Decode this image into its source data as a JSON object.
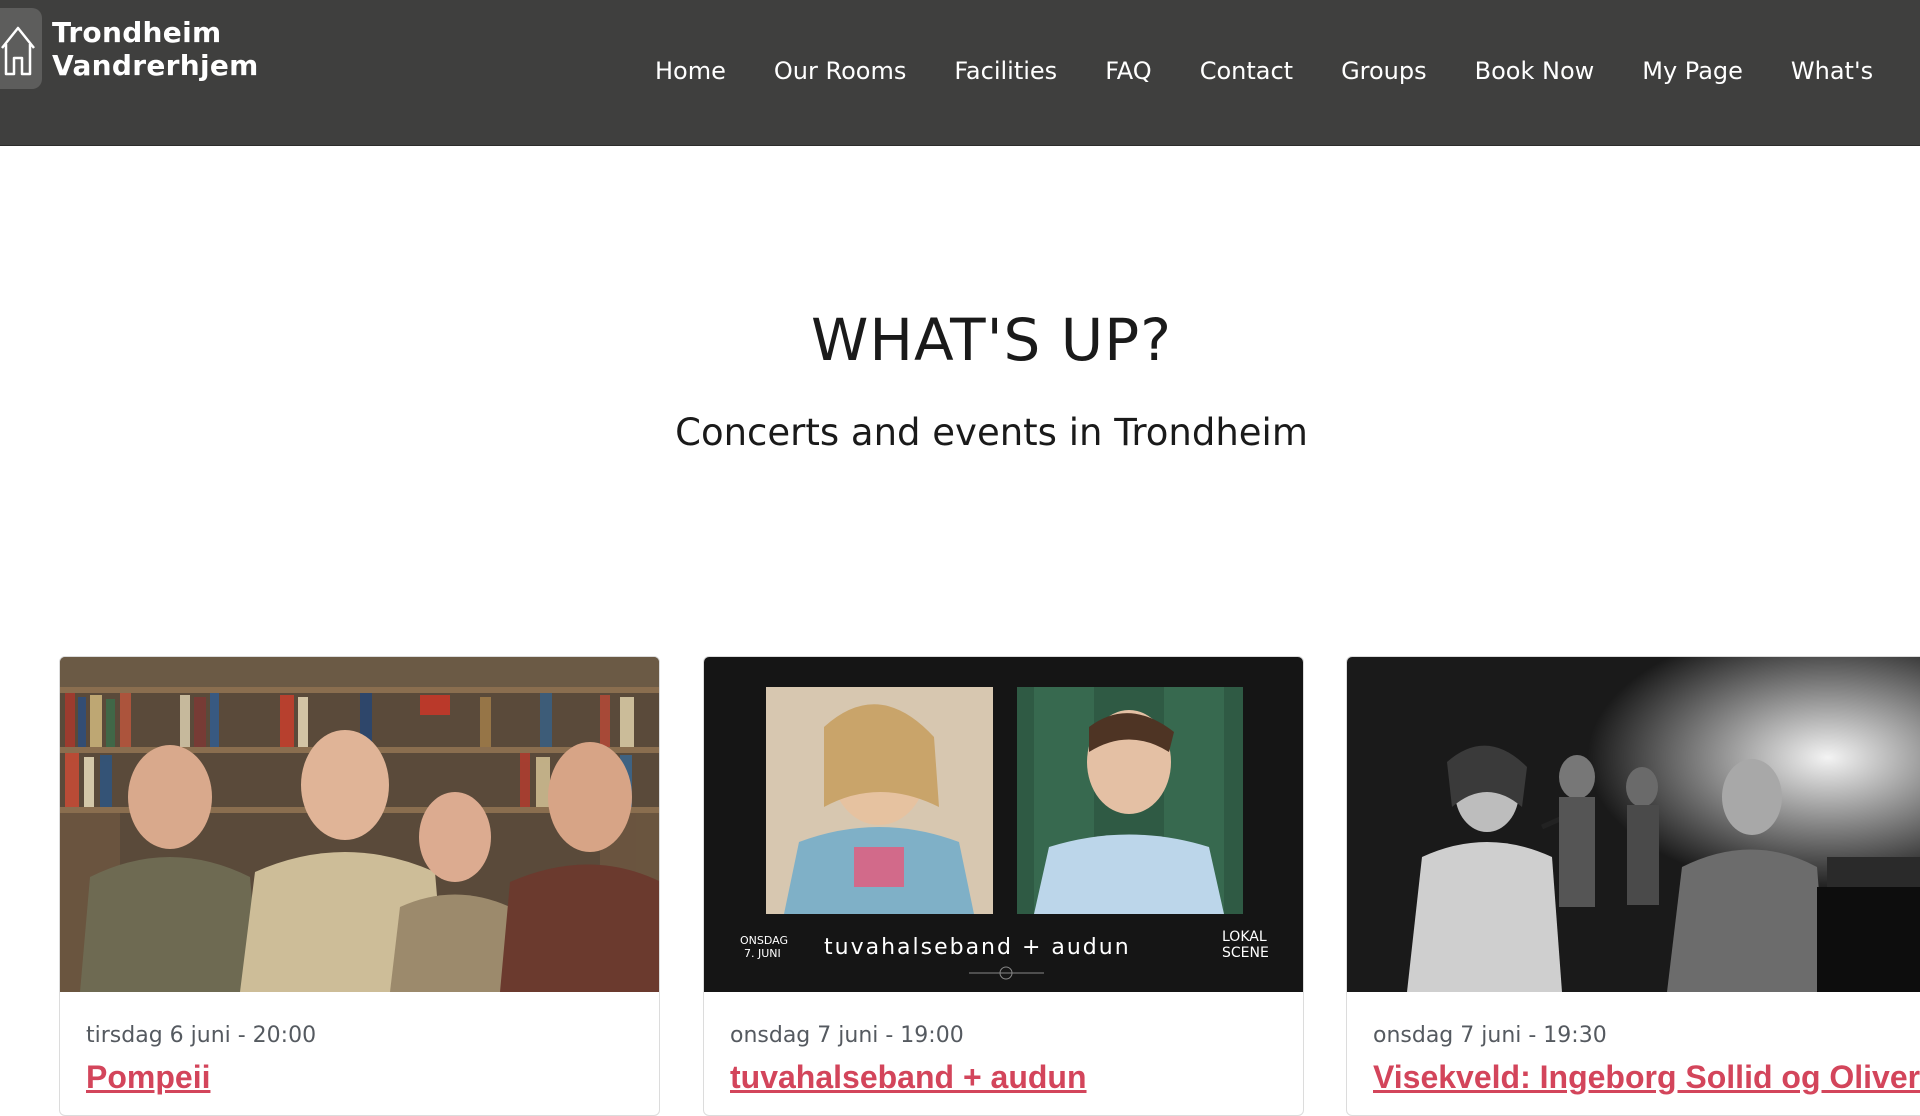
{
  "brand": {
    "line1": "Trondheim",
    "line2": "Vandrerhjem",
    "icon": "house-icon"
  },
  "nav": {
    "items": [
      {
        "label": "Home"
      },
      {
        "label": "Our Rooms"
      },
      {
        "label": "Facilities"
      },
      {
        "label": "FAQ"
      },
      {
        "label": "Contact"
      },
      {
        "label": "Groups"
      },
      {
        "label": "Book Now"
      },
      {
        "label": "My Page"
      },
      {
        "label": "What's"
      }
    ]
  },
  "hero": {
    "title": "WHAT'S UP?",
    "subtitle": "Concerts and events in Trondheim"
  },
  "events": [
    {
      "date": "tirsdag 6 juni - 20:00",
      "title": "Pompeii"
    },
    {
      "date": "onsdag 7 juni - 19:00",
      "title": "tuvahalseband + audun",
      "poster": {
        "day": "ONSDAG",
        "date": "7. JUNI",
        "band": "tuvahalseband + audun",
        "venue_line1": "LOKAL",
        "venue_line2": "SCENE"
      }
    },
    {
      "date": "onsdag 7 juni - 19:30",
      "title": "Visekveld: Ingeborg Sollid og Oliver"
    }
  ],
  "colors": {
    "navbar": "#3f3f3e",
    "accent": "#d3455b",
    "text": "#1a1a1a",
    "muted": "#555a60"
  }
}
